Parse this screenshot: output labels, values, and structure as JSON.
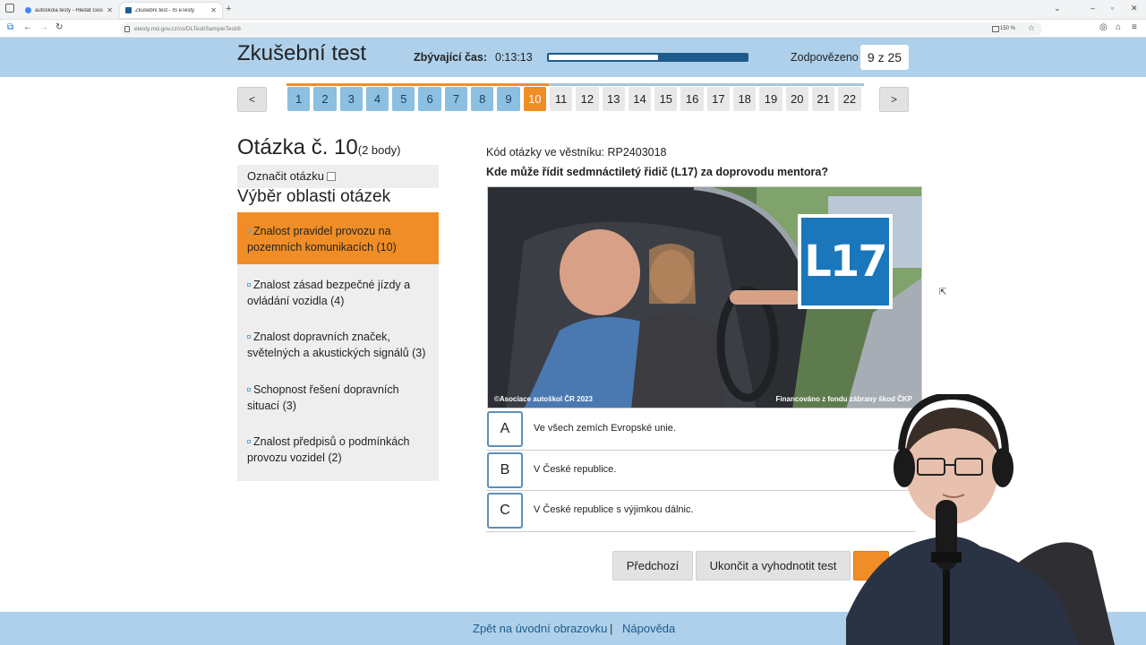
{
  "browser": {
    "tabs": [
      {
        "title": "autoškola testy - Hledat Goog"
      },
      {
        "title": "Zkušební test - IS eTesty"
      }
    ],
    "url": "etesty.md.gov.cz/cs/DLTest/SampleTest/8",
    "zoom": "150 %"
  },
  "header": {
    "title": "Zkušební test",
    "time_label": "Zbývající čas:",
    "time_value": "0:13:13",
    "time_progress_fraction": 0.55,
    "answered_label": "Zodpovězeno",
    "answered_value": "9 z 25"
  },
  "qnav": {
    "prev": "<",
    "next": ">",
    "numbers": [
      "1",
      "2",
      "3",
      "4",
      "5",
      "6",
      "7",
      "8",
      "9",
      "10",
      "11",
      "12",
      "13",
      "14",
      "15",
      "16",
      "17",
      "18",
      "19",
      "20",
      "21",
      "22"
    ],
    "answered_count": 9,
    "current": 10
  },
  "question": {
    "heading": "Otázka č. 10",
    "points": "(2 body)",
    "mark_label": "Označit otázku",
    "code": "Kód otázky ve věstníku: RP2403018",
    "text": "Kde může řídit sedmnáctiletý řidič (L17) za doprovodu mentora?",
    "image_badge": "L17",
    "image_copyright": "©Asociace autoškol ČR 2023",
    "image_funding": "Financováno z fondu zábrany škod ČKP",
    "options": [
      {
        "letter": "A",
        "text": "Ve všech zemích Evropské unie."
      },
      {
        "letter": "B",
        "text": "V České republice."
      },
      {
        "letter": "C",
        "text": "V České republice s výjimkou dálnic."
      }
    ]
  },
  "areas": {
    "heading": "Výběr oblasti otázek",
    "items": [
      {
        "label": "Znalost pravidel provozu na pozemních komunikacích (10)"
      },
      {
        "label": "Znalost zásad bezpečné jízdy a ovládání vozidla (4)"
      },
      {
        "label": "Znalost dopravních značek, světelných a akustických signálů (3)"
      },
      {
        "label": "Schopnost řešení dopravních situací (3)"
      },
      {
        "label": "Znalost předpisů o podmínkách provozu vozidel (2)"
      }
    ]
  },
  "buttons": {
    "previous": "Předchozí",
    "finish": "Ukončit a vyhodnotit test"
  },
  "footer": {
    "back": "Zpět na úvodní obrazovku",
    "separator": "|",
    "help": "Nápověda"
  },
  "colors": {
    "header_bg": "#aed0ea",
    "accent_orange": "#f18d26",
    "dark_blue": "#1d5b8d",
    "answered_blue": "#8dbfe0"
  }
}
